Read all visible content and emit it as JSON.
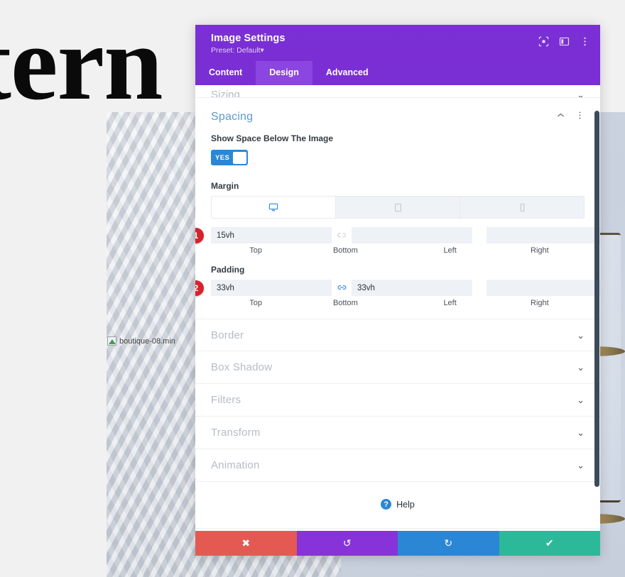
{
  "background": {
    "hero_text": "tern",
    "image_alt": "boutique-08.min",
    "broken_image_icon": "broken-image-icon"
  },
  "modal": {
    "title": "Image Settings",
    "preset_label": "Preset: Default",
    "preset_caret": "▾",
    "header_icons": [
      {
        "name": "focus-icon"
      },
      {
        "name": "layout-columns-icon"
      },
      {
        "name": "more-vertical-icon"
      }
    ],
    "tabs": [
      {
        "label": "Content",
        "active": false
      },
      {
        "label": "Design",
        "active": true
      },
      {
        "label": "Advanced",
        "active": false
      }
    ],
    "accordion_top": {
      "label": "Sizing",
      "chevron": "⌄"
    },
    "spacing": {
      "title": "Spacing",
      "collapse_chevron": "⌃",
      "more_icon": "more-vertical-icon",
      "toggle": {
        "label": "Show Space Below The Image",
        "value": "YES"
      },
      "margin": {
        "group_label": "Margin",
        "devices": [
          {
            "name": "desktop-icon",
            "active": true
          },
          {
            "name": "tablet-icon",
            "active": false
          },
          {
            "name": "phone-icon",
            "active": false
          }
        ],
        "badge": "1",
        "link_top_bottom": "unlinked",
        "link_left_right": "unlinked",
        "fields": [
          {
            "side": "Top",
            "value": "15vh"
          },
          {
            "side": "Bottom",
            "value": ""
          },
          {
            "side": "Left",
            "value": ""
          },
          {
            "side": "Right",
            "value": ""
          }
        ]
      },
      "padding": {
        "group_label": "Padding",
        "badge": "2",
        "link_top_bottom": "linked",
        "link_left_right": "unlinked",
        "fields": [
          {
            "side": "Top",
            "value": "33vh"
          },
          {
            "side": "Bottom",
            "value": "33vh"
          },
          {
            "side": "Left",
            "value": ""
          },
          {
            "side": "Right",
            "value": ""
          }
        ]
      }
    },
    "accordions": [
      {
        "label": "Border",
        "chevron": "⌄"
      },
      {
        "label": "Box Shadow",
        "chevron": "⌄"
      },
      {
        "label": "Filters",
        "chevron": "⌄"
      },
      {
        "label": "Transform",
        "chevron": "⌄"
      },
      {
        "label": "Animation",
        "chevron": "⌄"
      }
    ],
    "help": {
      "icon_text": "?",
      "label": "Help"
    },
    "footer": [
      {
        "name": "cancel-button",
        "glyph": "✖"
      },
      {
        "name": "undo-button",
        "glyph": "↺"
      },
      {
        "name": "redo-button",
        "glyph": "↻"
      },
      {
        "name": "save-button",
        "glyph": "✔"
      }
    ]
  },
  "colors": {
    "header_purple": "#7a2fd4",
    "tab_active": "#8b45e0",
    "section_title_blue": "#5a9bd4",
    "toggle_blue": "#2b87d6",
    "badge_red": "#d6232c",
    "cancel_red": "#e45a52",
    "undo_purple": "#8733d9",
    "redo_blue": "#2b87d6",
    "save_teal": "#2bb99a"
  }
}
